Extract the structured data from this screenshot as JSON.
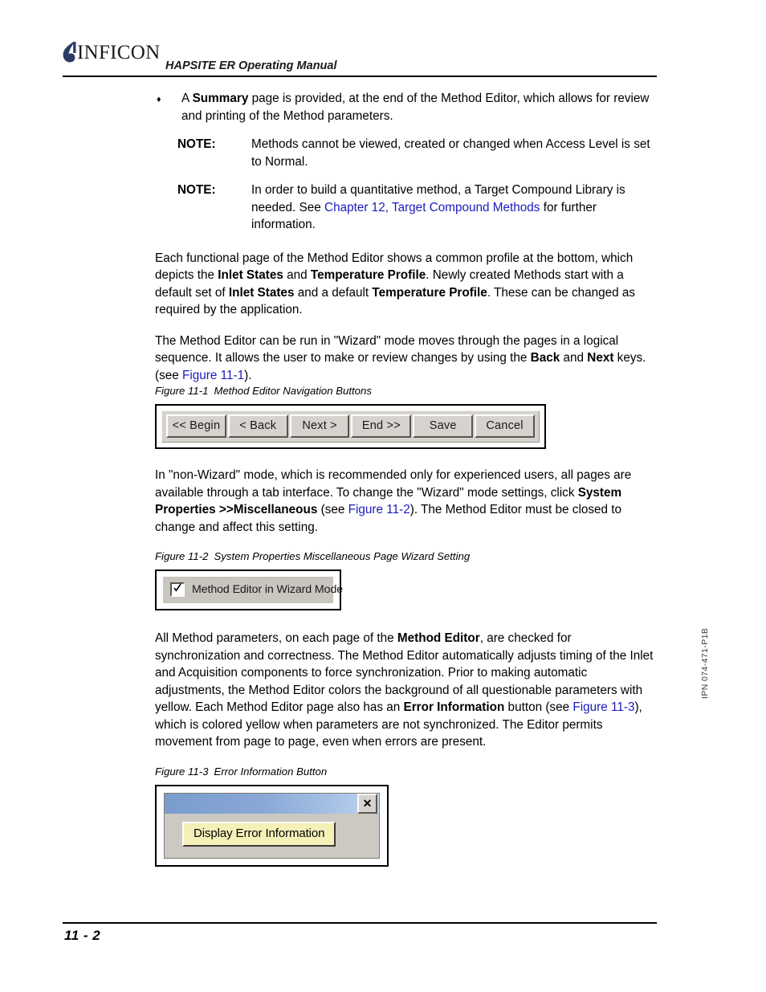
{
  "header": {
    "logo_text": "INFICON",
    "logo_icon": "inficon-droplet-logo",
    "manual_title": "HAPSITE ER Operating Manual"
  },
  "bullet": {
    "glyph": "♦",
    "text_before": "A ",
    "bold_1": "Summary",
    "text_after": " page is provided, at the end of the Method Editor, which allows for review and printing of the Method parameters."
  },
  "notes": [
    {
      "label": "NOTE:",
      "text": "Methods cannot be viewed, created or changed when Access Level is set to Normal."
    },
    {
      "label": "NOTE:",
      "text_before": "In order to build a quantitative method, a Target Compound Library is needed. See ",
      "link": "Chapter 12, Target Compound Methods",
      "text_after": " for further information."
    }
  ],
  "paragraphs": {
    "p1_a": "Each functional page of the Method Editor shows a common profile at the bottom, which depicts the ",
    "p1_b1": "Inlet States",
    "p1_b": " and ",
    "p1_b2": "Temperature Profile",
    "p1_c": ". Newly created Methods start with a default set of ",
    "p1_b3": "Inlet States",
    "p1_d": " and a default ",
    "p1_b4": "Temperature Profile",
    "p1_e": ". These can be changed as required by the application.",
    "p2_a": "The Method Editor can be run in \"Wizard\" mode moves through the pages in a logical sequence. It allows the user to make or review changes by using the ",
    "p2_b1": "Back",
    "p2_b": " and ",
    "p2_b2": "Next",
    "p2_c": " keys. (see ",
    "p2_link": "Figure 11-1",
    "p2_d": ").",
    "p3_a": "In \"non-Wizard\" mode, which is recommended only for experienced users, all pages are available through a tab interface. To change the \"Wizard\" mode settings, click ",
    "p3_b1": "System Properties >>Miscellaneous",
    "p3_b": " (see ",
    "p3_link": "Figure 11-2",
    "p3_c": "). The Method Editor must be closed to change and affect this setting.",
    "p4_a": "All Method parameters, on each page of the ",
    "p4_b1": "Method Editor",
    "p4_b": ", are checked for synchronization and correctness. The Method Editor automatically adjusts timing of the Inlet and Acquisition components to force synchronization. Prior to making automatic adjustments, the Method Editor colors the background of all questionable parameters with yellow. Each Method Editor page also has an ",
    "p4_b2": "Error Information",
    "p4_c": " button (see ",
    "p4_link": "Figure 11-3",
    "p4_d": "), which is colored yellow when parameters are not synchronized. The Editor permits movement from page to page, even when errors are present."
  },
  "figures": {
    "fig1": {
      "number": "Figure 11-1",
      "title": "Method Editor Navigation Buttons",
      "buttons": [
        "<< Begin",
        "< Back",
        "Next >",
        "End >>",
        "Save",
        "Cancel"
      ]
    },
    "fig2": {
      "number": "Figure 11-2",
      "title": "System Properties Miscellaneous Page Wizard Setting",
      "checkbox_label": "Method Editor in Wizard Mode",
      "checkbox_checked": true
    },
    "fig3": {
      "number": "Figure 11-3",
      "title": "Error Information Button",
      "close_glyph": "✕",
      "button_label": "Display Error Information",
      "button_color": "#f5f0b8",
      "titlebar_color_left": "#7a9ccd",
      "titlebar_color_right": "#c3d6ef"
    }
  },
  "footer": {
    "page_number": "11 - 2",
    "side_code": "IPN 074-471-P1B"
  }
}
